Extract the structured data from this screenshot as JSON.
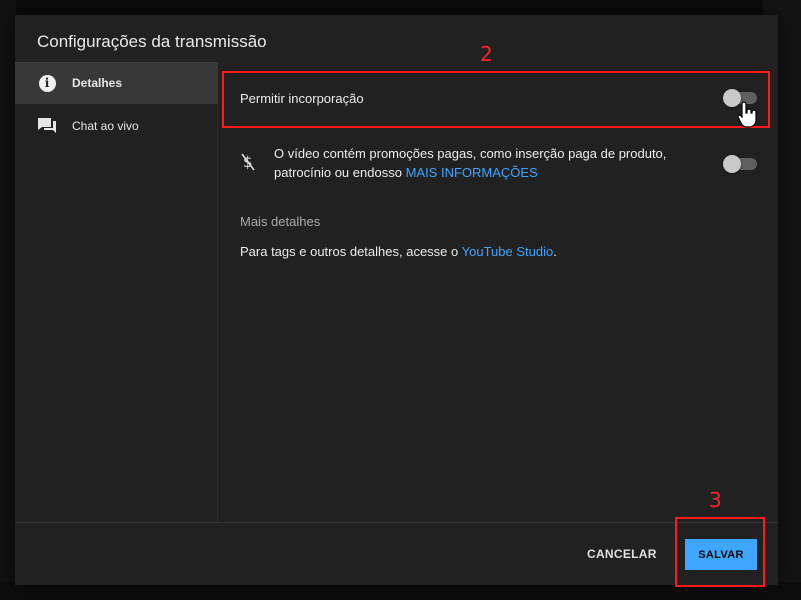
{
  "dialog": {
    "title": "Configurações da transmissão"
  },
  "sidebar": {
    "items": [
      {
        "label": "Detalhes",
        "icon": "info-icon",
        "active": true
      },
      {
        "label": "Chat ao vivo",
        "icon": "chat-icon",
        "active": false
      }
    ]
  },
  "settings": {
    "embed_label": "Permitir incorporação",
    "embed_enabled": false,
    "promo_text": "O vídeo contém promoções pagas, como inserção paga de produto, patrocínio ou endosso",
    "promo_link": "MAIS INFORMAÇÕES",
    "promo_enabled": false,
    "promo_icon": "money-off-icon"
  },
  "more_details": {
    "title": "Mais detalhes",
    "body_prefix": "Para tags e outros detalhes, acesse o",
    "link": "YouTube Studio",
    "body_suffix": "."
  },
  "footer": {
    "cancel_label": "CANCELAR",
    "save_label": "SALVAR"
  },
  "annotations": {
    "step2": "2",
    "step3": "3",
    "color": "#ff1a1a"
  },
  "colors": {
    "accent": "#3ea6ff",
    "dialog_bg": "#212121"
  }
}
